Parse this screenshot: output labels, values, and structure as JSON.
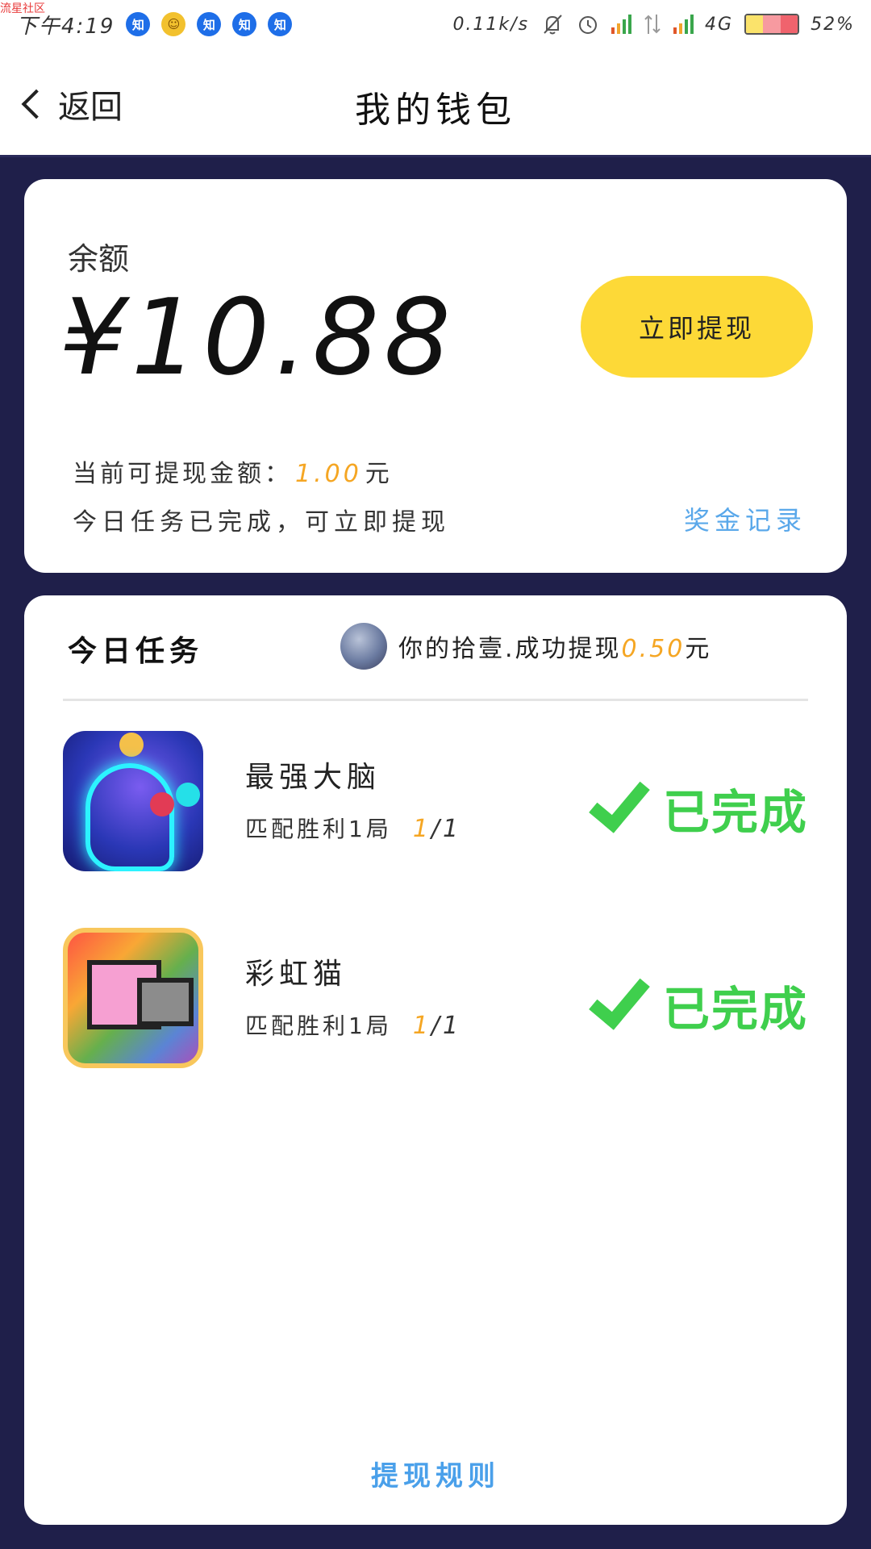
{
  "status_bar": {
    "watermark": "流星社区",
    "time": "下午4:19",
    "notif_icons": [
      "知",
      "☺",
      "知",
      "知",
      "知"
    ],
    "net_speed": "0.11k/s",
    "network_type": "4G",
    "battery": "52%",
    "icons": [
      "mute-icon",
      "alarm-icon",
      "signal-icon",
      "data-transfer-icon",
      "signal-icon",
      "battery-icon"
    ]
  },
  "nav": {
    "back_label": "返回",
    "title": "我的钱包"
  },
  "balance": {
    "label": "余额",
    "amount": "¥10.88",
    "withdraw_button": "立即提现",
    "available_prefix": "当前可提现金额：",
    "available_amount": "1.00",
    "available_unit": "元",
    "status_line": "今日任务已完成，可立即提现",
    "record_link": "奖金记录"
  },
  "tasks": {
    "title": "今日任务",
    "ticker_text": "你的拾壹.成功提现",
    "ticker_amount": "0.50",
    "ticker_unit": "元",
    "items": [
      {
        "name": "最强大脑",
        "desc": "匹配胜利1局",
        "progress_done": "1",
        "progress_total": "/1",
        "status": "已完成"
      },
      {
        "name": "彩虹猫",
        "desc": "匹配胜利1局",
        "progress_done": "1",
        "progress_total": "/1",
        "status": "已完成"
      }
    ],
    "rules_link": "提现规则"
  },
  "colors": {
    "accent_yellow": "#fdd937",
    "amount_orange": "#f5a623",
    "link_blue": "#5aa8ea",
    "success_green": "#3fcf4d",
    "background": "#1f1f4a"
  }
}
